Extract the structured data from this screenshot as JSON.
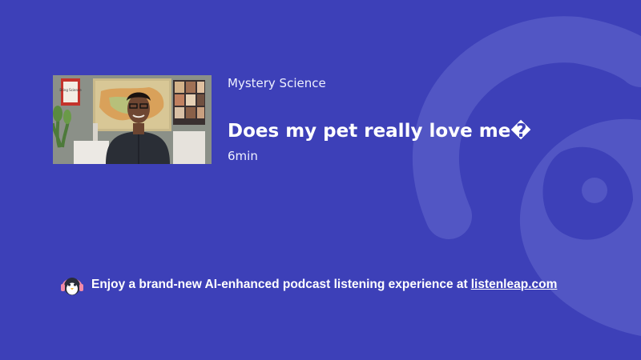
{
  "episode": {
    "show_name": "Mystery Science",
    "title": "Does my pet really love me�",
    "duration": "6min",
    "thumbnail": {
      "poster_text": "Bring Science"
    }
  },
  "promo": {
    "text": "Enjoy a brand-new AI-enhanced podcast listening experience at",
    "link_text": "listenleap.com",
    "icon": "penguin-headphones-icon"
  },
  "colors": {
    "background": "#3d40b8",
    "watermark": "#5457c6",
    "text": "#ffffff"
  }
}
